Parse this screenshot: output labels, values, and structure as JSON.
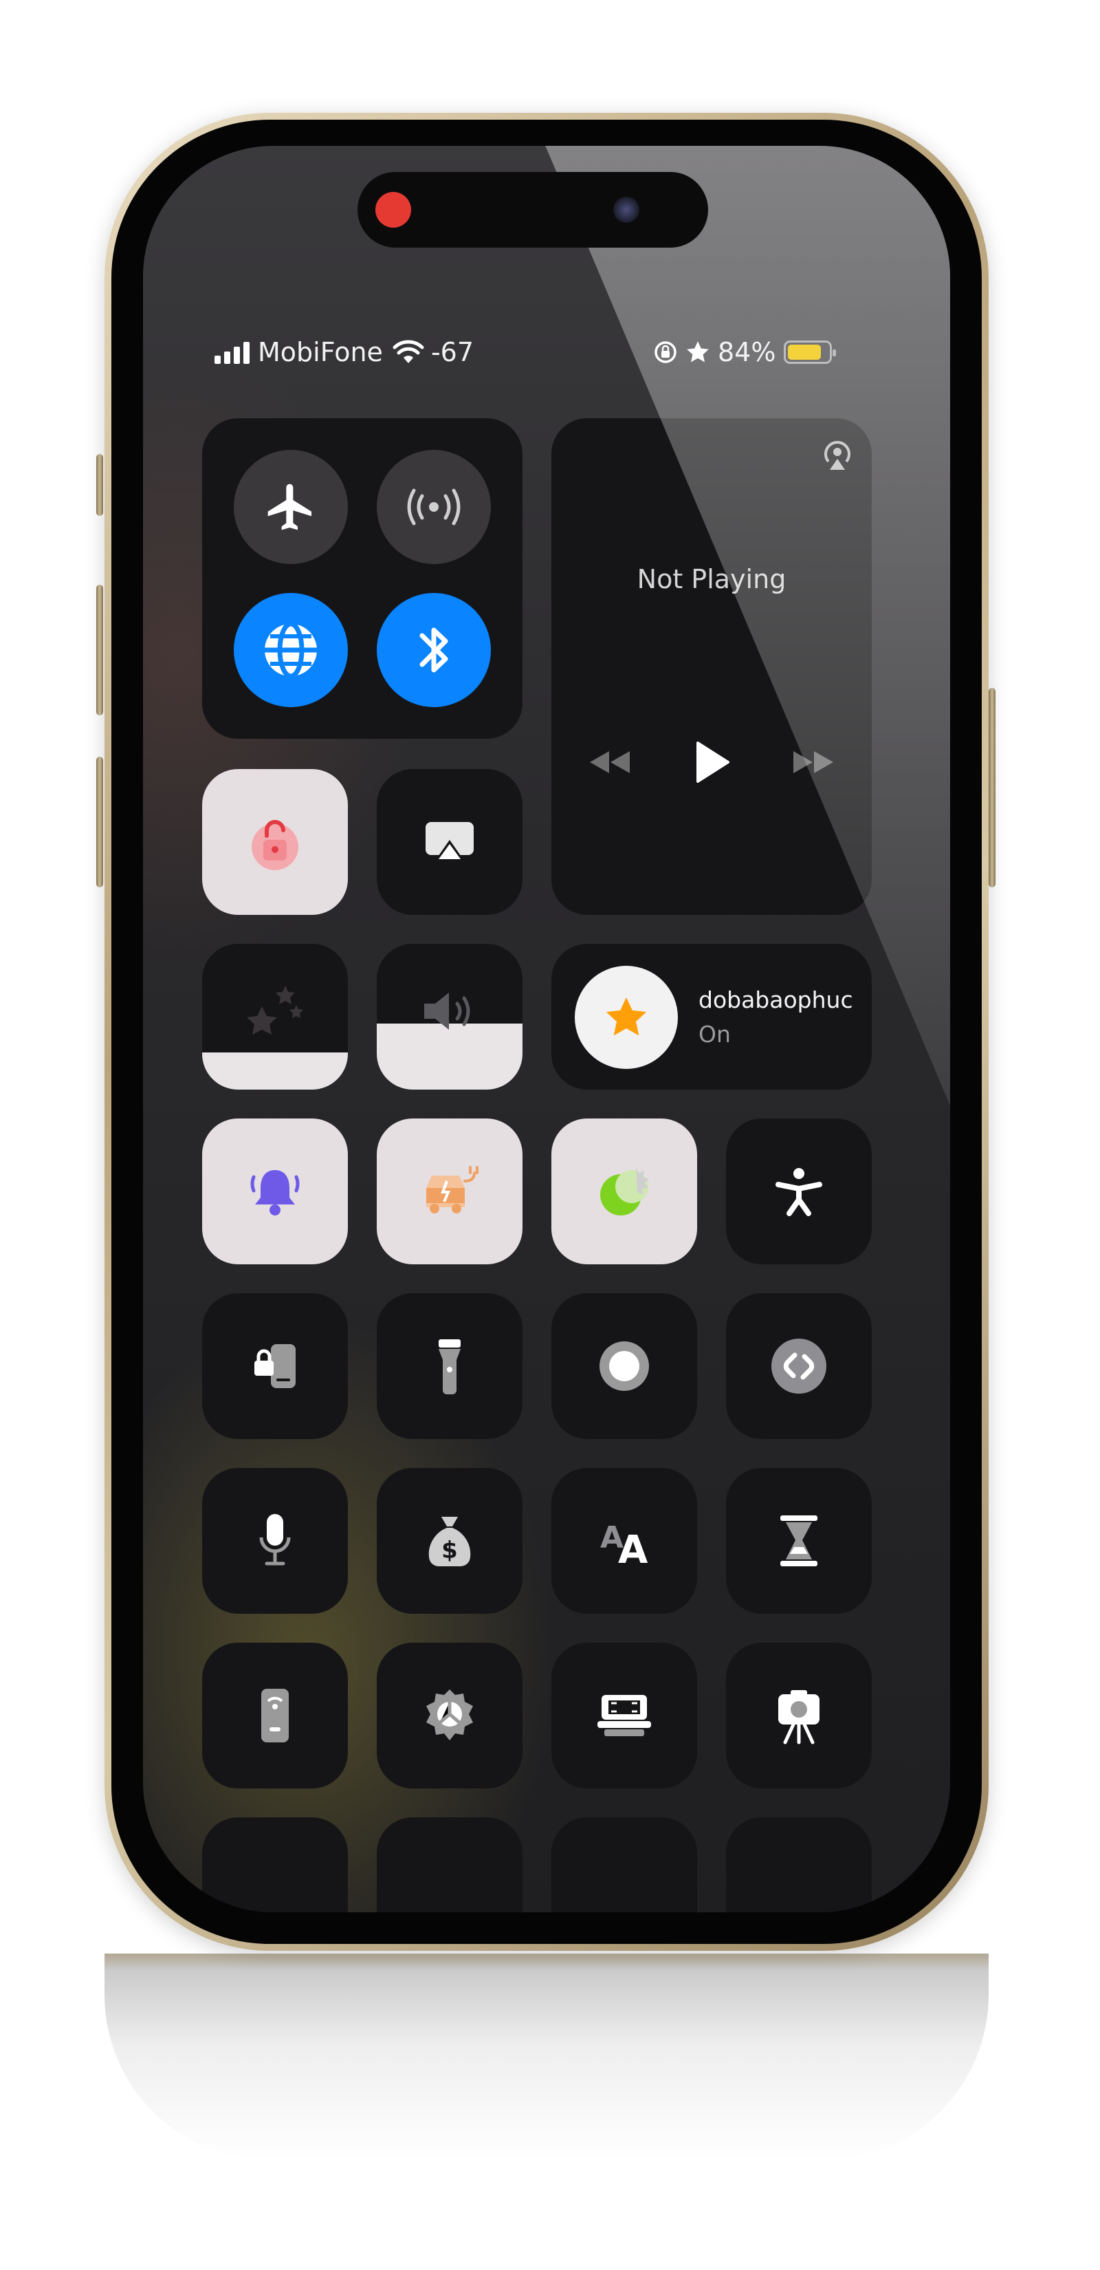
{
  "status_bar": {
    "carrier": "MobiFone",
    "signal_value": "-67",
    "battery_percent": "84%"
  },
  "now_playing": {
    "label": "Not Playing"
  },
  "focus": {
    "name": "dobabaophuc",
    "state": "On"
  },
  "colors": {
    "accent_blue": "#0a84ff",
    "recording_red": "#e53a32",
    "battery_yellow": "#f4d23c",
    "focus_star": "#ff9f0a",
    "bell_purple": "#6e5ae6",
    "charging_orange": "#f0a060",
    "green_mode": "#7ed321"
  },
  "icons": [
    "airplane-icon",
    "cellular-data-icon",
    "wifi-globe-icon",
    "bluetooth-icon",
    "airplay-music-icon",
    "orientation-lock-icon",
    "screen-mirroring-icon",
    "brightness-icon",
    "volume-icon",
    "focus-star-icon",
    "bell-icon",
    "charging-car-icon",
    "dark-mode-icon",
    "accessibility-icon",
    "guided-access-icon",
    "flashlight-icon",
    "screen-record-icon",
    "shazam-icon",
    "voice-memo-icon",
    "money-bag-icon",
    "text-size-icon",
    "timer-hourglass-icon",
    "remote-icon",
    "settings-gear-icon",
    "scanner-icon",
    "camera-icon"
  ]
}
